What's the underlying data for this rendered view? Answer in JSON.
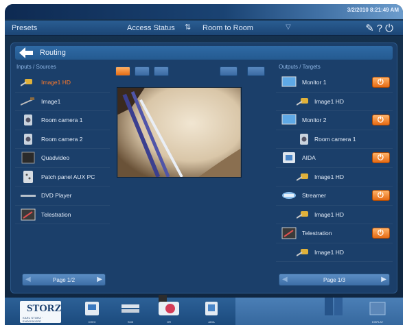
{
  "status": {
    "datetime": "3/2/2010 8:21:49 AM"
  },
  "menubar": {
    "presets": "Presets",
    "access_status": "Access Status",
    "room_to_room": "Room to Room",
    "icons": [
      "wrench-icon",
      "help-icon",
      "power-icon"
    ]
  },
  "routing": {
    "title": "Routing"
  },
  "inputs": {
    "label": "Inputs / Sources",
    "items": [
      {
        "label": "Image1 HD",
        "icon": "endoscope-camera-icon",
        "selected": true
      },
      {
        "label": "Image1",
        "icon": "endoscope-icon",
        "selected": false
      },
      {
        "label": "Room camera 1",
        "icon": "room-camera-icon",
        "selected": false
      },
      {
        "label": "Room camera 2",
        "icon": "room-camera-icon",
        "selected": false
      },
      {
        "label": "Quadvideo",
        "icon": "quadvideo-icon",
        "selected": false
      },
      {
        "label": "Patch panel AUX PC",
        "icon": "patch-panel-icon",
        "selected": false
      },
      {
        "label": "DVD Player",
        "icon": "dvd-icon",
        "selected": false
      },
      {
        "label": "Telestration",
        "icon": "telestration-icon",
        "selected": false
      }
    ],
    "pager": "Page 1/2"
  },
  "outputs": {
    "label": "Outputs / Targets",
    "items": [
      {
        "label": "Monitor 1",
        "icon": "monitor-icon",
        "power": true
      },
      {
        "label": "Image1 HD",
        "icon": "endoscope-camera-icon",
        "sub": true
      },
      {
        "label": "Monitor 2",
        "icon": "monitor-icon",
        "power": true
      },
      {
        "label": "Room camera 1",
        "icon": "room-camera-icon",
        "sub": true
      },
      {
        "label": "AIDA",
        "icon": "aida-icon",
        "power": true
      },
      {
        "label": "Image1 HD",
        "icon": "endoscope-camera-icon",
        "sub": true
      },
      {
        "label": "Streamer",
        "icon": "streamer-icon",
        "power": true
      },
      {
        "label": "Image1 HD",
        "icon": "endoscope-camera-icon",
        "sub": true
      },
      {
        "label": "Telestration",
        "icon": "telestration-icon",
        "power": true
      },
      {
        "label": "Image1 HD",
        "icon": "endoscope-camera-icon",
        "sub": true
      }
    ],
    "pager": "Page 1/3"
  },
  "dock": {
    "logo": "STORZ",
    "logo_sub": "KARL STORZ · ENDOSKOPE",
    "items": [
      "CHEX",
      "SCB",
      "OR",
      "AIDA"
    ],
    "right_items": [
      "",
      "DISPLAY"
    ]
  },
  "colors": {
    "accent_orange": "#ff7a2a",
    "panel_blue": "#1b3f6a",
    "bar_blue": "#2a5d92"
  }
}
